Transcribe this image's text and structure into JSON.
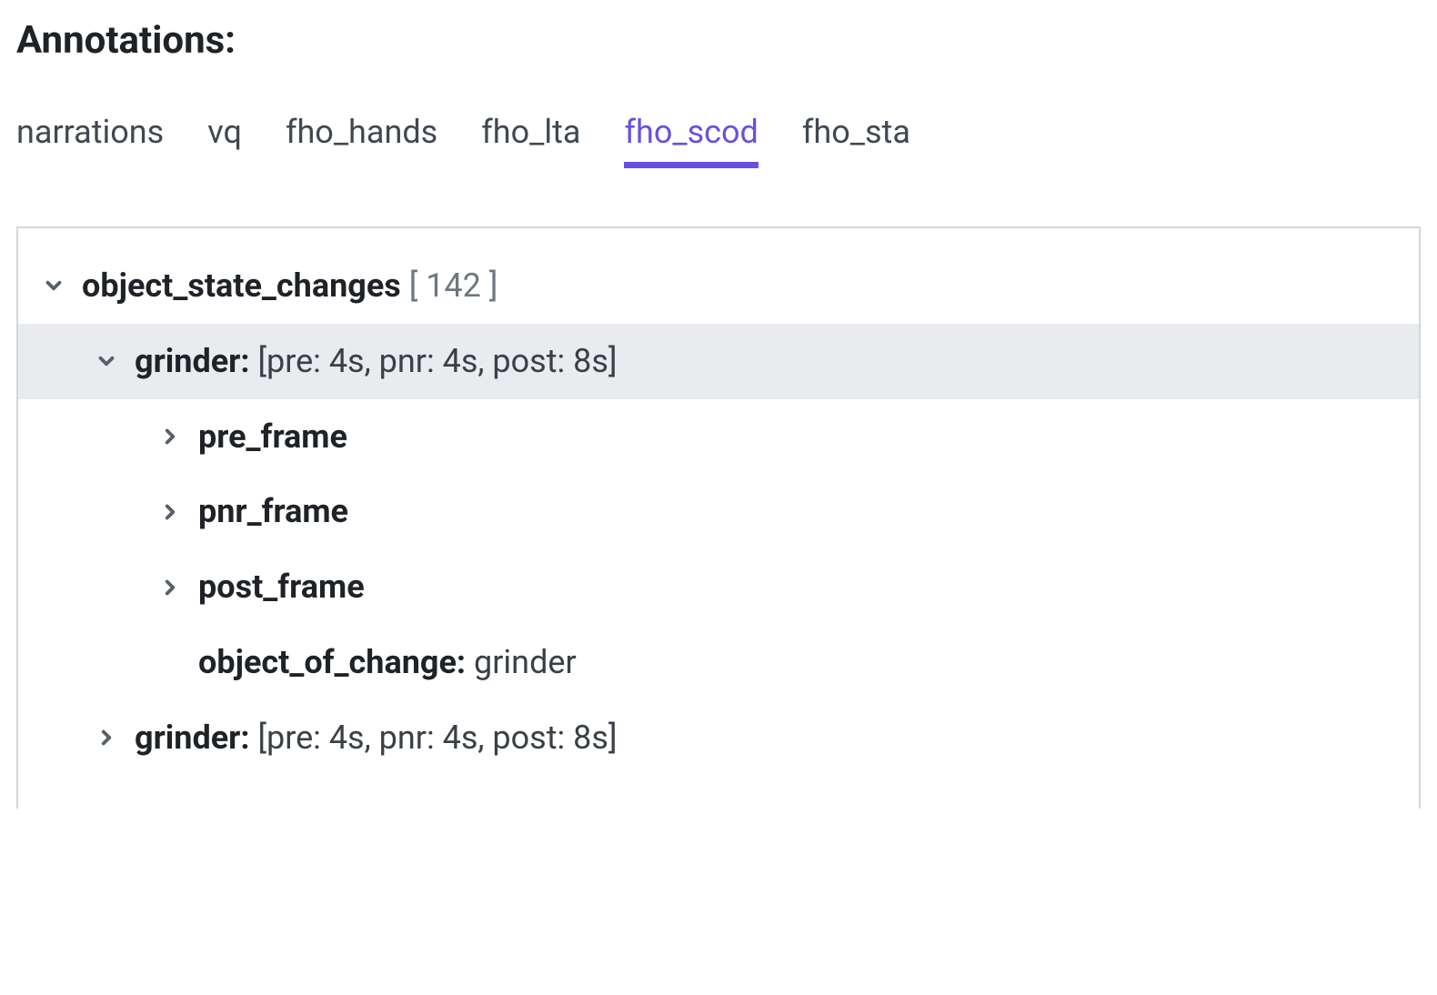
{
  "header": {
    "title": "Annotations:"
  },
  "tabs": {
    "items": [
      {
        "label": "narrations",
        "active": false
      },
      {
        "label": "vq",
        "active": false
      },
      {
        "label": "fho_hands",
        "active": false
      },
      {
        "label": "fho_lta",
        "active": false
      },
      {
        "label": "fho_scod",
        "active": true
      },
      {
        "label": "fho_sta",
        "active": false
      }
    ]
  },
  "tree": {
    "root": {
      "key": "object_state_changes",
      "count": "[ 142 ]"
    },
    "item_expanded": {
      "key": "grinder",
      "summary": "[pre: 4s, pnr: 4s, post: 8s]",
      "children": {
        "pre": "pre_frame",
        "pnr": "pnr_frame",
        "post": "post_frame",
        "ooc_key": "object_of_change",
        "ooc_value": "grinder"
      }
    },
    "item_collapsed": {
      "key": "grinder",
      "summary": "[pre: 4s, pnr: 4s, post: 8s]"
    }
  }
}
